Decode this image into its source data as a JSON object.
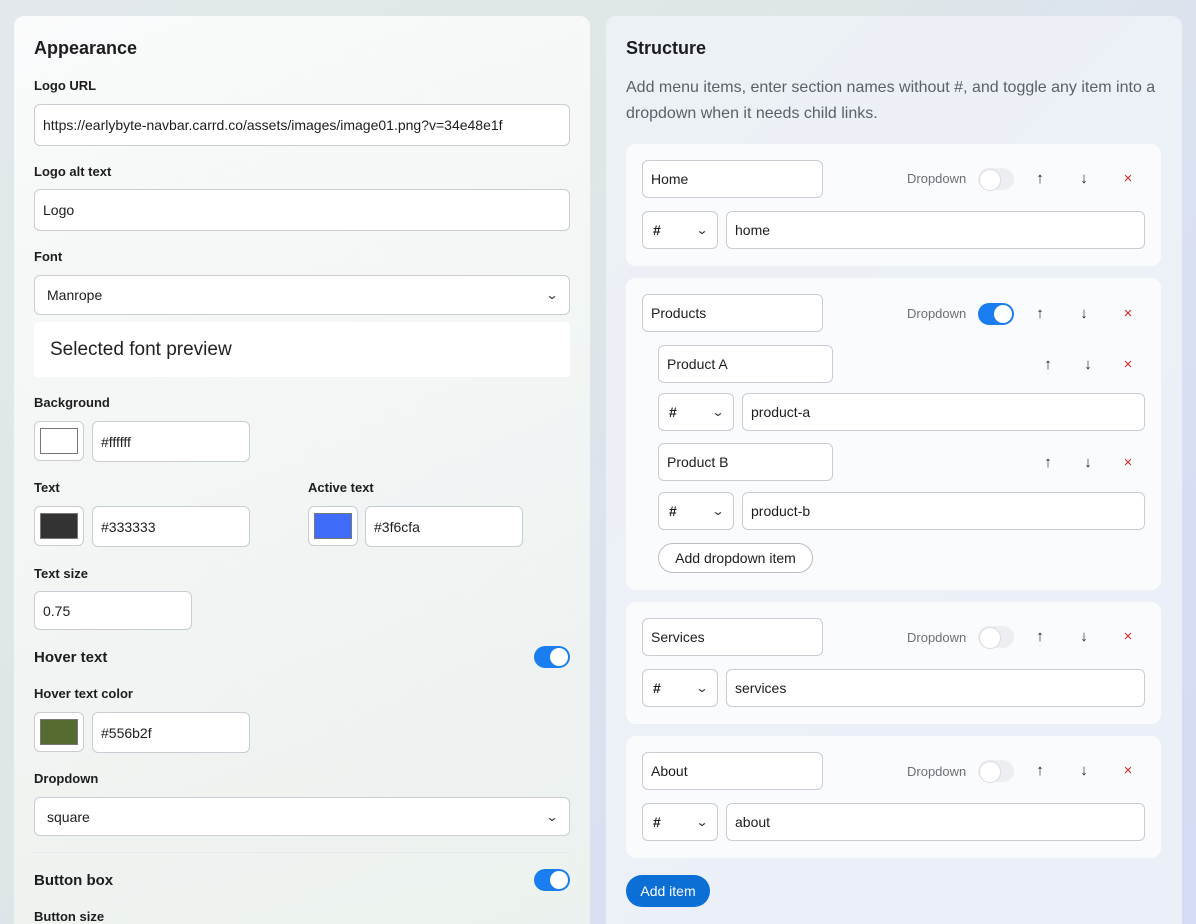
{
  "appearance": {
    "title": "Appearance",
    "logo_url": {
      "label": "Logo URL",
      "value": "https://earlybyte-navbar.carrd.co/assets/images/image01.png?v=34e48e1f"
    },
    "logo_alt": {
      "label": "Logo alt text",
      "value": "Logo"
    },
    "font": {
      "label": "Font",
      "value": "Manrope",
      "preview": "Selected font preview"
    },
    "background": {
      "label": "Background",
      "value": "#ffffff",
      "swatch": "#ffffff"
    },
    "text": {
      "label": "Text",
      "value": "#333333",
      "swatch": "#333333"
    },
    "active_text": {
      "label": "Active text",
      "value": "#3f6cfa",
      "swatch": "#3f6cfa"
    },
    "text_size": {
      "label": "Text size",
      "value": "0.75"
    },
    "hover_text": {
      "label": "Hover text",
      "enabled": true
    },
    "hover_text_color": {
      "label": "Hover text color",
      "value": "#556b2f",
      "swatch": "#556b2f"
    },
    "dropdown": {
      "label": "Dropdown",
      "value": "square"
    },
    "button_box": {
      "label": "Button box",
      "enabled": true
    },
    "button_size": {
      "label": "Button size"
    }
  },
  "structure": {
    "title": "Structure",
    "description": "Add menu items, enter section names without #, and toggle any item into a dropdown when it needs child links.",
    "dropdown_label": "Dropdown",
    "prefix": "#",
    "items": [
      {
        "name": "Home",
        "section": "home",
        "dropdown": false
      },
      {
        "name": "Products",
        "section": "",
        "dropdown": true,
        "children": [
          {
            "name": "Product A",
            "section": "product-a"
          },
          {
            "name": "Product B",
            "section": "product-b"
          }
        ]
      },
      {
        "name": "Services",
        "section": "services",
        "dropdown": false
      },
      {
        "name": "About",
        "section": "about",
        "dropdown": false
      }
    ],
    "add_dropdown_item": "Add dropdown item",
    "add_item": "Add item",
    "icons": {
      "up": "arrow-up-icon",
      "down": "arrow-down-icon",
      "remove": "close-icon"
    }
  }
}
